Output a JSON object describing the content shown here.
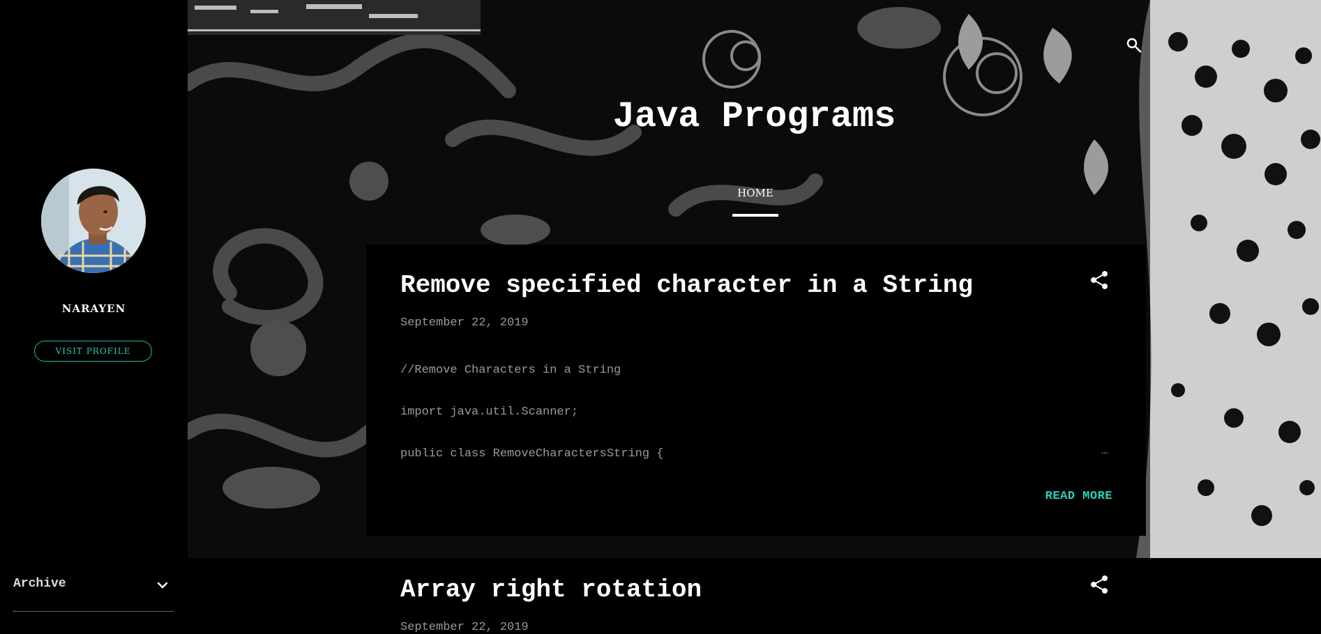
{
  "sidebar": {
    "profile_name": "NARAYEN",
    "visit_profile_label": "VISIT PROFILE",
    "archive_label": "Archive"
  },
  "header": {
    "blog_title": "Java Programs",
    "nav_home": "HOME",
    "search_icon": "search-icon"
  },
  "posts": [
    {
      "title": "Remove specified character in a String",
      "date": "September 22, 2019",
      "snippet": [
        "//Remove Characters in a String",
        "import java.util.Scanner;",
        "public class RemoveCharactersString {"
      ],
      "ellipsis": "…",
      "read_more": "READ MORE"
    },
    {
      "title": "Array right rotation",
      "date": "September 22, 2019"
    }
  ],
  "colors": {
    "accent": "#26c6b2",
    "background": "#000000",
    "muted_text": "#9a9a9a"
  }
}
